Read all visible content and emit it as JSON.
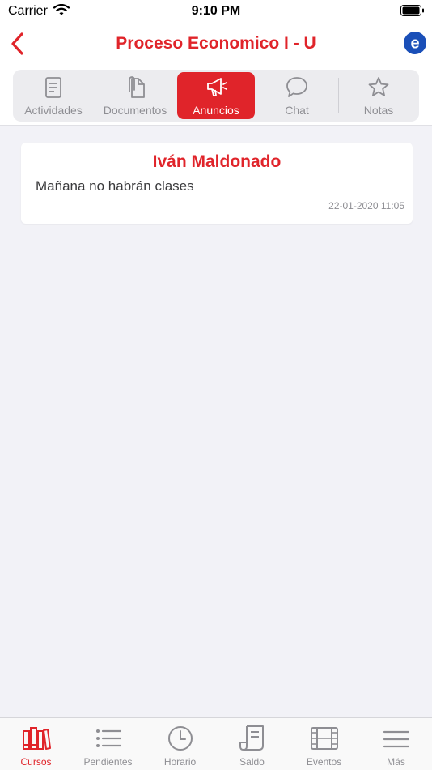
{
  "status_bar": {
    "carrier": "Carrier",
    "time": "9:10 PM"
  },
  "nav": {
    "title": "Proceso Economico I - U",
    "brand_letter": "e",
    "accent": "#e0242a"
  },
  "segments": [
    {
      "label": "Actividades",
      "icon": "document-icon"
    },
    {
      "label": "Documentos",
      "icon": "paperclip-document-icon"
    },
    {
      "label": "Anuncios",
      "icon": "megaphone-icon",
      "active": true
    },
    {
      "label": "Chat",
      "icon": "chat-bubble-icon"
    },
    {
      "label": "Notas",
      "icon": "star-icon"
    }
  ],
  "announcement": {
    "author": "Iván Maldonado",
    "message": "Mañana no habrán clases",
    "date": "22-01-2020 11:05"
  },
  "tabs": [
    {
      "label": "Cursos",
      "icon": "books-icon",
      "active": true
    },
    {
      "label": "Pendientes",
      "icon": "list-icon"
    },
    {
      "label": "Horario",
      "icon": "clock-icon"
    },
    {
      "label": "Saldo",
      "icon": "receipt-icon"
    },
    {
      "label": "Eventos",
      "icon": "film-icon"
    },
    {
      "label": "Más",
      "icon": "menu-icon"
    }
  ]
}
